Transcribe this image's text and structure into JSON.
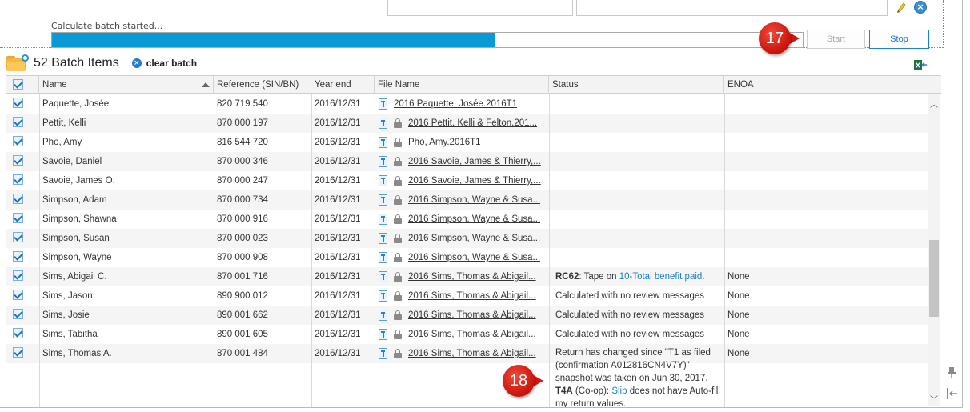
{
  "progress": {
    "label": "Calculate batch started...",
    "fraction": 0.59
  },
  "buttons": {
    "start_label": "Start",
    "stop_label": "Stop"
  },
  "callouts": {
    "c17": "17",
    "c18": "18"
  },
  "batch": {
    "title": "52 Batch Items",
    "clear_label": "clear batch"
  },
  "columns": {
    "name": "Name",
    "reference": "Reference (SIN/BN)",
    "year_end": "Year end",
    "file_name": "File Name",
    "status": "Status",
    "enoa": "ENOA"
  },
  "rows": [
    {
      "name": "Paquette, Josée",
      "ref": "820 719 540",
      "year": "2016/12/31",
      "file": "2016 Paquette, Josée.2016T1",
      "locked": false,
      "status_bold": "",
      "status_text": "",
      "status_link": "",
      "status_tail": "",
      "enoa": ""
    },
    {
      "name": "Pettit, Kelli",
      "ref": "870 000 197",
      "year": "2016/12/31",
      "file": "2016 Pettit, Kelli & Felton.201...",
      "locked": true,
      "status_bold": "",
      "status_text": "",
      "status_link": "",
      "status_tail": "",
      "enoa": ""
    },
    {
      "name": "Pho, Amy",
      "ref": "816 544 720",
      "year": "2016/12/31",
      "file": "Pho, Amy.2016T1",
      "locked": true,
      "status_bold": "",
      "status_text": "",
      "status_link": "",
      "status_tail": "",
      "enoa": ""
    },
    {
      "name": "Savoie, Daniel",
      "ref": "870 000 346",
      "year": "2016/12/31",
      "file": "2016 Savoie, James & Thierry,...",
      "locked": true,
      "status_bold": "",
      "status_text": "",
      "status_link": "",
      "status_tail": "",
      "enoa": ""
    },
    {
      "name": "Savoie, James O.",
      "ref": "870 000 247",
      "year": "2016/12/31",
      "file": "2016 Savoie, James & Thierry,...",
      "locked": true,
      "status_bold": "",
      "status_text": "",
      "status_link": "",
      "status_tail": "",
      "enoa": ""
    },
    {
      "name": "Simpson, Adam",
      "ref": "870 000 734",
      "year": "2016/12/31",
      "file": "2016 Simpson, Wayne & Susa...",
      "locked": true,
      "status_bold": "",
      "status_text": "",
      "status_link": "",
      "status_tail": "",
      "enoa": ""
    },
    {
      "name": "Simpson, Shawna",
      "ref": "870 000 916",
      "year": "2016/12/31",
      "file": "2016 Simpson, Wayne & Susa...",
      "locked": true,
      "status_bold": "",
      "status_text": "",
      "status_link": "",
      "status_tail": "",
      "enoa": ""
    },
    {
      "name": "Simpson, Susan",
      "ref": "870 000 023",
      "year": "2016/12/31",
      "file": "2016 Simpson, Wayne & Susa...",
      "locked": true,
      "status_bold": "",
      "status_text": "",
      "status_link": "",
      "status_tail": "",
      "enoa": ""
    },
    {
      "name": "Simpson, Wayne",
      "ref": "870 000 908",
      "year": "2016/12/31",
      "file": "2016 Simpson, Wayne & Susa...",
      "locked": true,
      "status_bold": "",
      "status_text": "",
      "status_link": "",
      "status_tail": "",
      "enoa": ""
    },
    {
      "name": "Sims, Abigail C.",
      "ref": "870 001 716",
      "year": "2016/12/31",
      "file": "2016 Sims, Thomas & Abigail...",
      "locked": true,
      "status_bold": "RC62",
      "status_text": ": Tape on ",
      "status_link": "10-Total benefit paid",
      "status_tail": ".",
      "enoa": "None"
    },
    {
      "name": "Sims, Jason",
      "ref": "890 900 012",
      "year": "2016/12/31",
      "file": "2016 Sims, Thomas & Abigail...",
      "locked": true,
      "status_bold": "",
      "status_text": "Calculated with no review messages",
      "status_link": "",
      "status_tail": "",
      "enoa": "None"
    },
    {
      "name": "Sims, Josie",
      "ref": "890 001 662",
      "year": "2016/12/31",
      "file": "2016 Sims, Thomas & Abigail...",
      "locked": true,
      "status_bold": "",
      "status_text": "Calculated with no review messages",
      "status_link": "",
      "status_tail": "",
      "enoa": "None"
    },
    {
      "name": "Sims, Tabitha",
      "ref": "890 001 605",
      "year": "2016/12/31",
      "file": "2016 Sims, Thomas & Abigail...",
      "locked": true,
      "status_bold": "",
      "status_text": "Calculated with no review messages",
      "status_link": "",
      "status_tail": "",
      "enoa": "None"
    },
    {
      "name": "Sims, Thomas A.",
      "ref": "870 001 484",
      "year": "2016/12/31",
      "file": "2016 Sims, Thomas & Abigail...",
      "locked": true,
      "status_bold": "",
      "status_text": "",
      "status_link": "",
      "status_tail": "",
      "enoa": "None"
    }
  ],
  "last_row_status": {
    "line1": "Return has changed since \"T1 as filed (confirmation A012816CN4V7Y)\" snapshot was taken on Jun 30, 2017.",
    "t4a_bold": "T4A",
    "t4a_text": " (Co-op): ",
    "t4a_link": "Slip",
    "t4a_tail": " does not have Auto-fill my return values."
  },
  "icons": {
    "pencil": "pencil-icon",
    "close": "close-icon",
    "folder": "folder-icon",
    "clear": "clear-icon",
    "excel": "excel-export-icon",
    "t1file": "t1-file-icon",
    "lock": "lock-icon",
    "pin": "pin-icon",
    "dock": "dock-icon"
  },
  "colors": {
    "progress": "#0a9ad6",
    "callout": "#d0180f",
    "link": "#1f80c8",
    "stop_border": "#1f80d0"
  }
}
